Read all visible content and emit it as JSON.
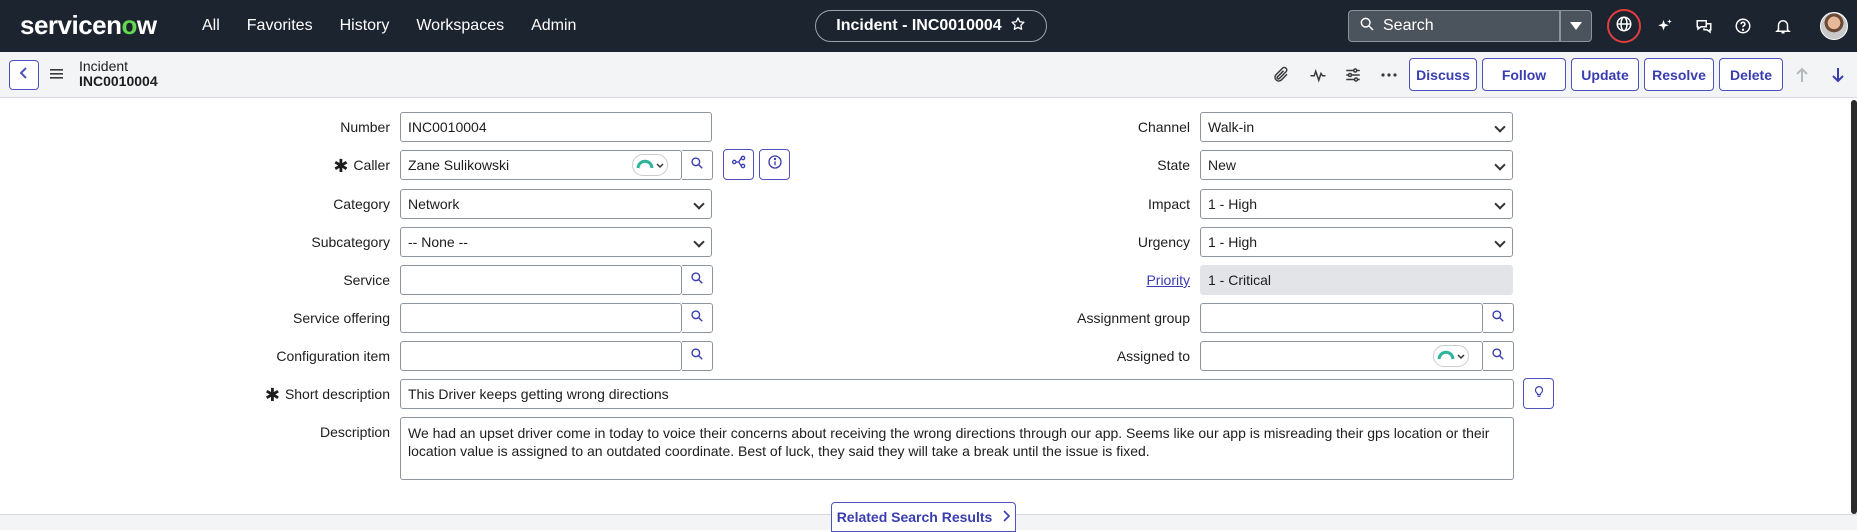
{
  "nav": {
    "logo": "servicenow",
    "menu": [
      "All",
      "Favorites",
      "History",
      "Workspaces",
      "Admin"
    ],
    "context_title": "Incident - INC0010004",
    "search_placeholder": "Search"
  },
  "header": {
    "record_type": "Incident",
    "record_number": "INC0010004",
    "buttons": {
      "discuss": "Discuss",
      "follow": "Follow",
      "update": "Update",
      "resolve": "Resolve",
      "delete": "Delete"
    }
  },
  "form": {
    "left": {
      "number": {
        "label": "Number",
        "value": "INC0010004"
      },
      "caller": {
        "label": "Caller",
        "value": "Zane Sulikowski"
      },
      "category": {
        "label": "Category",
        "value": "Network"
      },
      "subcategory": {
        "label": "Subcategory",
        "value": "-- None --"
      },
      "service": {
        "label": "Service",
        "value": ""
      },
      "service_offering": {
        "label": "Service offering",
        "value": ""
      },
      "configuration_item": {
        "label": "Configuration item",
        "value": ""
      }
    },
    "right": {
      "channel": {
        "label": "Channel",
        "value": "Walk-in"
      },
      "state": {
        "label": "State",
        "value": "New"
      },
      "impact": {
        "label": "Impact",
        "value": "1 - High"
      },
      "urgency": {
        "label": "Urgency",
        "value": "1 - High"
      },
      "priority": {
        "label": "Priority",
        "value": "1 - Critical"
      },
      "assignment_group": {
        "label": "Assignment group",
        "value": ""
      },
      "assigned_to": {
        "label": "Assigned to",
        "value": ""
      }
    },
    "short_description": {
      "label": "Short description",
      "value": "This Driver keeps getting wrong directions"
    },
    "description": {
      "label": "Description",
      "value": "We had an upset driver come in today to voice their concerns about receiving the wrong directions through our app. Seems like our app is misreading their gps location or their location value is assigned to an outdated coordinate. Best of luck, they said they will take a break until the issue is fixed."
    }
  },
  "related_search": "Related Search Results",
  "colors": {
    "nav_bg": "#1c2430",
    "accent": "#4f52bd",
    "logo_green": "#62d84e"
  }
}
